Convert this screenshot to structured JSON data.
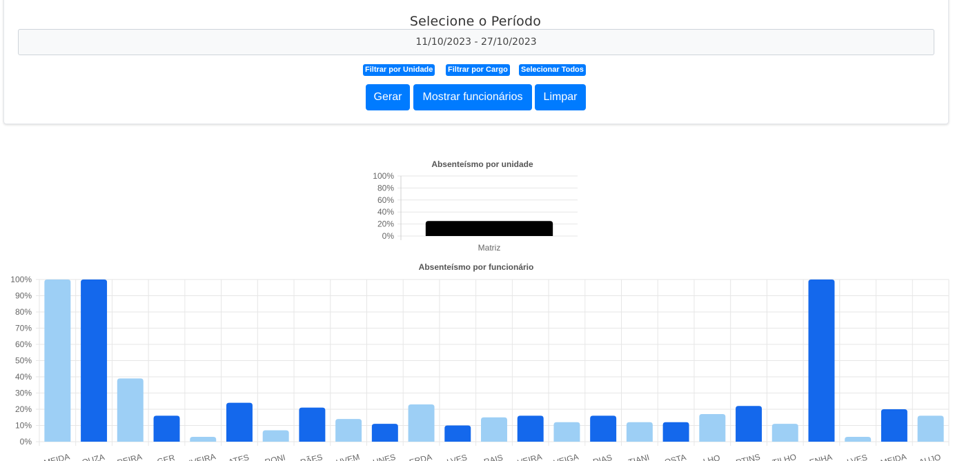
{
  "form": {
    "period_label": "Selecione o Período",
    "period_value": "11/10/2023 - 27/10/2023",
    "chips": {
      "filter_unit": "Filtrar por Unidade",
      "filter_role": "Filtrar por Cargo",
      "select_all": "Selecionar Todos"
    },
    "buttons": {
      "generate": "Gerar",
      "show_employees": "Mostrar funcionários",
      "clear": "Limpar"
    }
  },
  "chart_data": [
    {
      "type": "bar",
      "title": "Absenteísmo por unidade",
      "categories": [
        "Matriz"
      ],
      "values": [
        25
      ],
      "ylim": [
        0,
        100
      ],
      "yticks": [
        "0%",
        "20%",
        "40%",
        "60%",
        "80%",
        "100%"
      ],
      "colors": [
        "#000000"
      ]
    },
    {
      "type": "bar",
      "title": "Absenteísmo por funcionário",
      "categories": [
        "MEIDA",
        "OUZA",
        "REIRA",
        "GER",
        "IVEIRA",
        "ATES",
        "RONI",
        "RÃES",
        "UVEM",
        "UNES",
        "ERDA",
        "LVES",
        "RAIS",
        "VEIRA",
        "VEIGA",
        "DIAS",
        "TIANI",
        "OSTA",
        "LHO",
        "RTINS",
        "TILHO",
        "ENHA",
        "LVES",
        "MEIDA",
        "AUJO"
      ],
      "values": [
        100,
        100,
        39,
        16,
        3,
        24,
        7,
        21,
        14,
        11,
        23,
        10,
        15,
        16,
        12,
        16,
        12,
        12,
        17,
        22,
        11,
        100,
        3,
        20,
        16
      ],
      "ylim": [
        0,
        100
      ],
      "yticks": [
        "0%",
        "10%",
        "20%",
        "30%",
        "40%",
        "50%",
        "60%",
        "70%",
        "80%",
        "90%",
        "100%"
      ],
      "colors": [
        "#9dcff5",
        "#1468ec"
      ]
    }
  ]
}
